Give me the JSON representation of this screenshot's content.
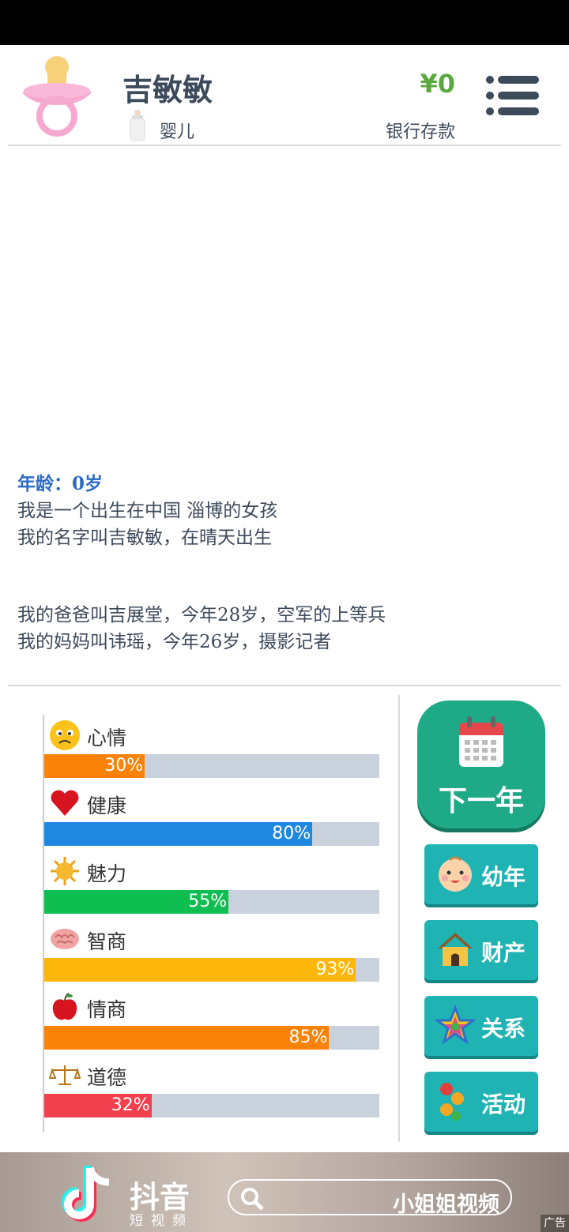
{
  "profile": {
    "name": "吉敏敏",
    "stage": "婴儿",
    "money": "¥0",
    "money_label": "银行存款"
  },
  "story": {
    "age_line": "年龄：0岁",
    "lines": [
      "我是一个出生在中国 淄博的女孩",
      "我的名字叫吉敏敏，在晴天出生",
      "",
      "我的爸爸叫吉展堂，今年28岁，空军的上等兵",
      "我的妈妈叫讳瑶，今年26岁，摄影记者"
    ]
  },
  "stats": [
    {
      "label": "心情",
      "value": 30,
      "pct_text": "30%",
      "color": "#fa8307",
      "icon": "sad-face-icon"
    },
    {
      "label": "健康",
      "value": 80,
      "pct_text": "80%",
      "color": "#1e88e0",
      "icon": "heart-icon"
    },
    {
      "label": "魅力",
      "value": 55,
      "pct_text": "55%",
      "color": "#0fbe50",
      "icon": "sun-icon"
    },
    {
      "label": "智商",
      "value": 93,
      "pct_text": "93%",
      "color": "#fdb70a",
      "icon": "brain-icon"
    },
    {
      "label": "情商",
      "value": 85,
      "pct_text": "85%",
      "color": "#fa8307",
      "icon": "apple-icon"
    },
    {
      "label": "道德",
      "value": 32,
      "pct_text": "32%",
      "color": "#f3404e",
      "icon": "scales-icon"
    }
  ],
  "actions": {
    "next_year": "下一年",
    "buttons": [
      {
        "label": "幼年",
        "icon": "baby-face-icon"
      },
      {
        "label": "财产",
        "icon": "house-icon"
      },
      {
        "label": "关系",
        "icon": "star-icon"
      },
      {
        "label": "活动",
        "icon": "dots-icon"
      }
    ]
  },
  "ad": {
    "brand": "抖音",
    "sub": "短视频",
    "search_text": "小姐姐视频",
    "tag": "广告"
  },
  "colors": {
    "accent_green": "#1ea987",
    "teal": "#1fb3b3",
    "money_green": "#5aa840",
    "age_blue": "#2d6bc5"
  }
}
